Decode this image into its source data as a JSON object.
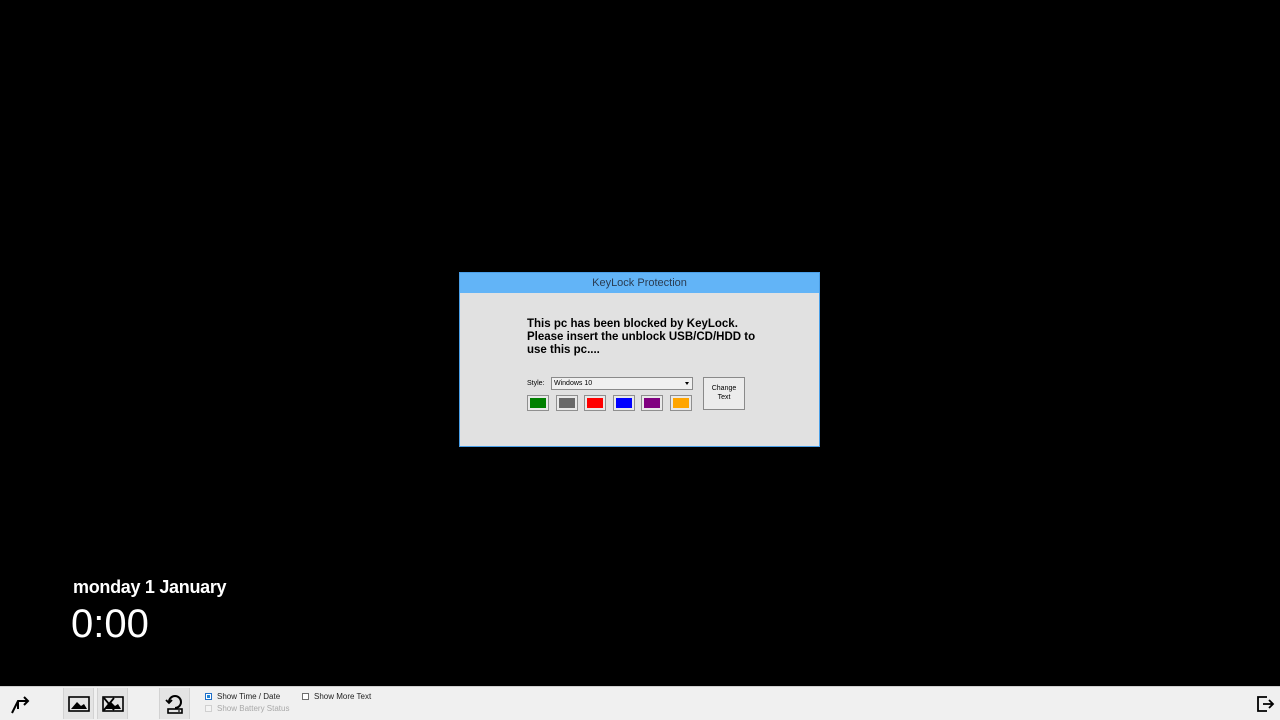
{
  "dialog": {
    "title": "KeyLock Protection",
    "message": "This pc has been blocked by KeyLock.\nPlease insert the unblock USB/CD/HDD to\nuse this pc....",
    "style_label": "Style:",
    "style_value": "Windows 10",
    "change_text_label": "Change\nText",
    "swatches": [
      {
        "name": "green",
        "color": "#008000"
      },
      {
        "name": "gray",
        "color": "#696969"
      },
      {
        "name": "red",
        "color": "#ff0000"
      },
      {
        "name": "blue",
        "color": "#0000ff"
      },
      {
        "name": "purple",
        "color": "#800080"
      },
      {
        "name": "orange",
        "color": "#ffa500"
      }
    ],
    "accent_color": "#62b4f7"
  },
  "clock": {
    "date": "monday 1 January",
    "time": "0:00"
  },
  "toolbar": {
    "icons": [
      "share-arrow-icon",
      "image-icon",
      "no-image-icon",
      "refresh-drive-icon",
      "exit-icon"
    ],
    "show_time_date": {
      "label": "Show Time / Date",
      "checked": true,
      "enabled": true
    },
    "show_battery_status": {
      "label": "Show Battery Status",
      "checked": false,
      "enabled": false
    },
    "show_more_text": {
      "label": "Show More Text",
      "checked": false,
      "enabled": true
    }
  }
}
